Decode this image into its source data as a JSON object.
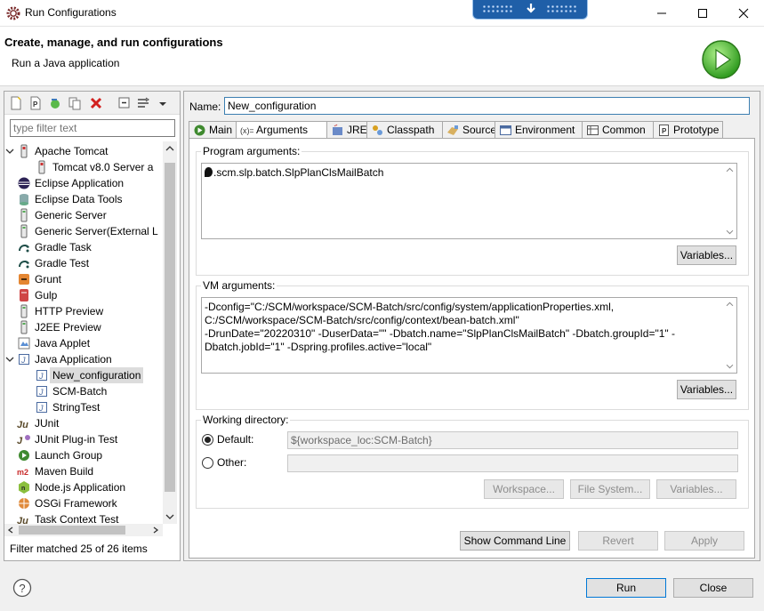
{
  "window": {
    "title": "Run Configurations"
  },
  "header": {
    "title": "Create, manage, and run configurations",
    "subtitle": "Run a Java application"
  },
  "left": {
    "filter_placeholder": "type filter text",
    "tree": [
      {
        "label": "Apache Tomcat",
        "level": 1,
        "expander": "expanded",
        "icon": "tomcat-icon"
      },
      {
        "label": "Tomcat v8.0 Server a",
        "level": 2,
        "expander": "",
        "icon": "tomcat-icon"
      },
      {
        "label": "Eclipse Application",
        "level": 1,
        "expander": "",
        "icon": "eclipse-icon"
      },
      {
        "label": "Eclipse Data Tools",
        "level": 1,
        "expander": "",
        "icon": "database-icon"
      },
      {
        "label": "Generic Server",
        "level": 1,
        "expander": "",
        "icon": "server-icon"
      },
      {
        "label": "Generic Server(External L",
        "level": 1,
        "expander": "",
        "icon": "server-icon"
      },
      {
        "label": "Gradle Task",
        "level": 1,
        "expander": "",
        "icon": "gradle-icon"
      },
      {
        "label": "Gradle Test",
        "level": 1,
        "expander": "",
        "icon": "gradle-icon"
      },
      {
        "label": "Grunt",
        "level": 1,
        "expander": "",
        "icon": "grunt-icon"
      },
      {
        "label": "Gulp",
        "level": 1,
        "expander": "",
        "icon": "gulp-icon"
      },
      {
        "label": "HTTP Preview",
        "level": 1,
        "expander": "",
        "icon": "server-icon"
      },
      {
        "label": "J2EE Preview",
        "level": 1,
        "expander": "",
        "icon": "server-icon"
      },
      {
        "label": "Java Applet",
        "level": 1,
        "expander": "",
        "icon": "applet-icon"
      },
      {
        "label": "Java Application",
        "level": 1,
        "expander": "expanded",
        "icon": "java-app-icon"
      },
      {
        "label": "New_configuration",
        "level": 2,
        "expander": "",
        "icon": "java-app-icon",
        "selected": true
      },
      {
        "label": "SCM-Batch",
        "level": 2,
        "expander": "",
        "icon": "java-app-icon"
      },
      {
        "label": "StringTest",
        "level": 2,
        "expander": "",
        "icon": "java-app-icon"
      },
      {
        "label": "JUnit",
        "level": 1,
        "expander": "",
        "icon": "junit-icon"
      },
      {
        "label": "JUnit Plug-in Test",
        "level": 1,
        "expander": "",
        "icon": "junit-plugin-icon"
      },
      {
        "label": "Launch Group",
        "level": 1,
        "expander": "",
        "icon": "launch-group-icon"
      },
      {
        "label": "Maven Build",
        "level": 1,
        "expander": "",
        "icon": "maven-icon"
      },
      {
        "label": "Node.js Application",
        "level": 1,
        "expander": "",
        "icon": "nodejs-icon"
      },
      {
        "label": "OSGi Framework",
        "level": 1,
        "expander": "",
        "icon": "osgi-icon"
      },
      {
        "label": "Task Context Test",
        "level": 1,
        "expander": "",
        "icon": "junit-icon"
      }
    ],
    "status": "Filter matched 25 of 26 items"
  },
  "right": {
    "name_label": "Name:",
    "name_value": "New_configuration",
    "tabs": [
      {
        "label": "Main",
        "icon": "main-tab-icon"
      },
      {
        "label": "Arguments",
        "icon": "arguments-tab-icon",
        "active": true
      },
      {
        "label": "JRE",
        "icon": "jre-tab-icon"
      },
      {
        "label": "Classpath",
        "icon": "classpath-tab-icon"
      },
      {
        "label": "Source",
        "icon": "source-tab-icon"
      },
      {
        "label": "Environment",
        "icon": "environment-tab-icon"
      },
      {
        "label": "Common",
        "icon": "common-tab-icon"
      },
      {
        "label": "Prototype",
        "icon": "prototype-tab-icon"
      }
    ],
    "program_args": {
      "title": "Program arguments:",
      "value": ".scm.slp.batch.SlpPlanClsMailBatch",
      "variables": "Variables..."
    },
    "vm_args": {
      "title": "VM arguments:",
      "lines": [
        "-Dconfig=\"C:/SCM/workspace/SCM-Batch/src/config/system/applicationProperties.xml,",
        "C:/SCM/workspace/SCM-Batch/src/config/context/bean-batch.xml\"",
        "-DrunDate=\"20220310\" -DuserData=\"\" -Dbatch.name=\"SlpPlanClsMailBatch\" -Dbatch.groupId=\"1\" -",
        "Dbatch.jobId=\"1\" -Dspring.profiles.active=\"local\""
      ],
      "variables": "Variables..."
    },
    "working_dir": {
      "title": "Working directory:",
      "default_label": "Default:",
      "default_value": "${workspace_loc:SCM-Batch}",
      "other_label": "Other:",
      "other_value": "",
      "workspace": "Workspace...",
      "filesystem": "File System...",
      "variables": "Variables..."
    },
    "show_command_line": "Show Command Line",
    "revert": "Revert",
    "apply": "Apply"
  },
  "footer": {
    "run": "Run",
    "close": "Close"
  }
}
